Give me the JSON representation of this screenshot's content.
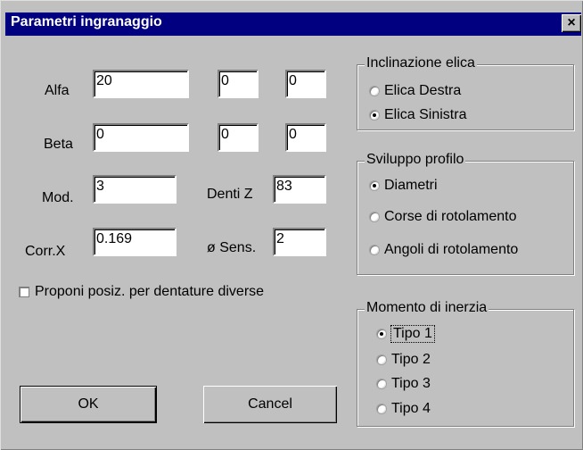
{
  "window": {
    "title": "Parametri ingranaggio",
    "close_label": "×"
  },
  "fields": {
    "alfa": {
      "label": "Alfa",
      "values": [
        "20",
        "0",
        "0"
      ]
    },
    "beta": {
      "label": "Beta",
      "values": [
        "0",
        "0",
        "0"
      ]
    },
    "mod": {
      "label": "Mod.",
      "value": "3"
    },
    "denti": {
      "label": "Denti Z",
      "value": "83"
    },
    "corr": {
      "label": "Corr.X",
      "value": "0.169"
    },
    "sens": {
      "label": "ø Sens.",
      "value": "2"
    }
  },
  "checkbox": {
    "label": "Proponi posiz. per dentature diverse",
    "checked": false
  },
  "inclinazione": {
    "legend": "Inclinazione elica",
    "options": [
      "Elica Destra",
      "Elica Sinistra"
    ],
    "selected": 1
  },
  "sviluppo": {
    "legend": "Sviluppo profilo",
    "options": [
      "Diametri",
      "Corse di rotolamento",
      "Angoli di rotolamento"
    ],
    "selected": 0
  },
  "momento": {
    "legend": "Momento di inerzia",
    "options": [
      "Tipo 1",
      "Tipo 2",
      "Tipo 3",
      "Tipo 4"
    ],
    "selected": 0
  },
  "buttons": {
    "ok": "OK",
    "cancel": "Cancel"
  },
  "colors": {
    "titlebar": "#000080",
    "face": "#c0c0c0"
  }
}
